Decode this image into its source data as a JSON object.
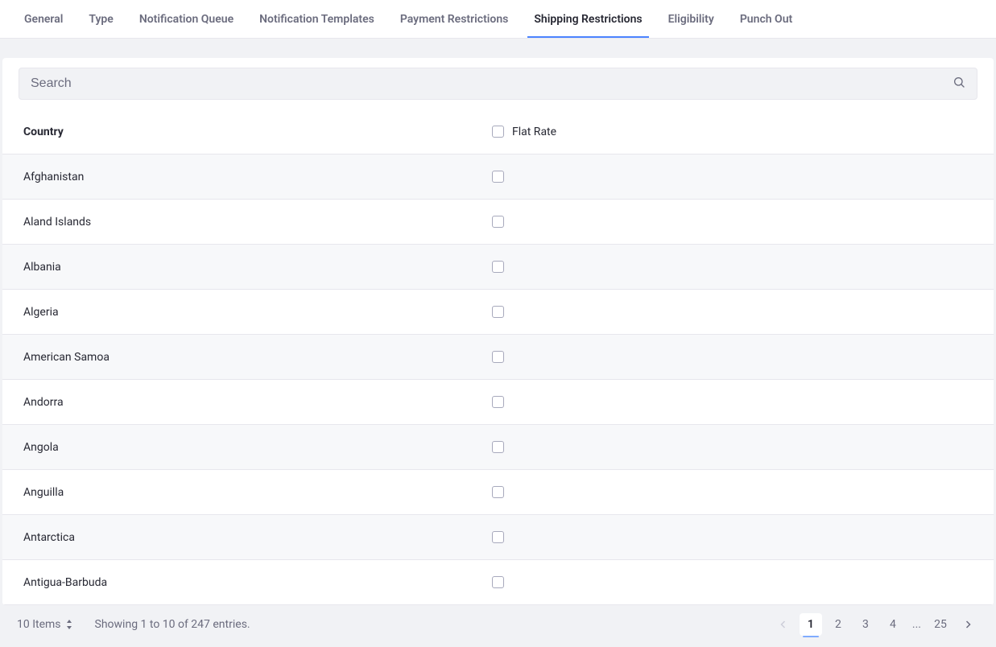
{
  "tabs": [
    {
      "label": "General",
      "active": false
    },
    {
      "label": "Type",
      "active": false
    },
    {
      "label": "Notification Queue",
      "active": false
    },
    {
      "label": "Notification Templates",
      "active": false
    },
    {
      "label": "Payment Restrictions",
      "active": false
    },
    {
      "label": "Shipping Restrictions",
      "active": true
    },
    {
      "label": "Eligibility",
      "active": false
    },
    {
      "label": "Punch Out",
      "active": false
    }
  ],
  "search": {
    "placeholder": "Search",
    "value": ""
  },
  "tableHeader": {
    "country": "Country",
    "flatRate": "Flat Rate"
  },
  "rows": [
    {
      "name": "Afghanistan",
      "checked": false
    },
    {
      "name": "Aland Islands",
      "checked": false
    },
    {
      "name": "Albania",
      "checked": false
    },
    {
      "name": "Algeria",
      "checked": false
    },
    {
      "name": "American Samoa",
      "checked": false
    },
    {
      "name": "Andorra",
      "checked": false
    },
    {
      "name": "Angola",
      "checked": false
    },
    {
      "name": "Anguilla",
      "checked": false
    },
    {
      "name": "Antarctica",
      "checked": false
    },
    {
      "name": "Antigua-Barbuda",
      "checked": false
    }
  ],
  "footer": {
    "itemsLabel": "10 Items",
    "showing": "Showing 1 to 10 of 247 entries.",
    "pages": [
      "1",
      "2",
      "3",
      "4",
      "...",
      "25"
    ],
    "activePage": "1"
  }
}
